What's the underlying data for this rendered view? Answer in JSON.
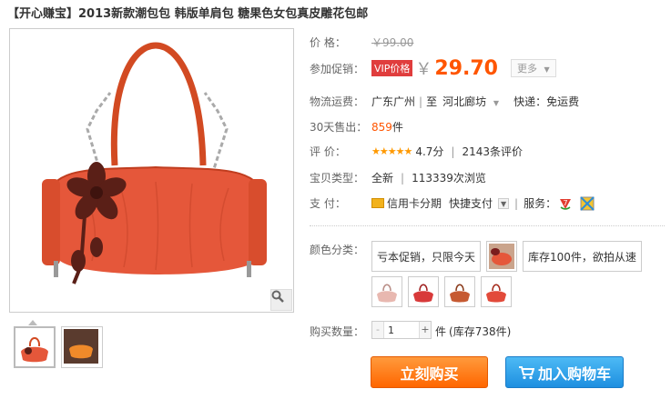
{
  "product": {
    "title": "【开心赚宝】2013新款潮包包 韩版单肩包 糖果色女包真皮雕花包邮"
  },
  "price": {
    "label": "价 格：",
    "original": "￥99.00",
    "promo_label": "参加促销：",
    "vip_tag": "VIP价格",
    "yen": "￥",
    "current": "29.70",
    "more": "更多"
  },
  "shipping": {
    "label": "物流运费：",
    "from": "广东广州",
    "to_word": "至",
    "to": "河北廊坊",
    "express": "快递：免运费"
  },
  "sales": {
    "label": "30天售出：",
    "count": "859",
    "unit": "件"
  },
  "rating": {
    "label": "评 价：",
    "stars": "★★★★★",
    "score": "4.7分",
    "reviews": "2143条评价"
  },
  "condition": {
    "label": "宝贝类型：",
    "type": "全新",
    "views": "113339次浏览"
  },
  "payment": {
    "label": "支 付：",
    "credit": "信用卡分期",
    "quick": "快捷支付",
    "service_label": "服务："
  },
  "colors": {
    "label": "颜色分类：",
    "option1": "亏本促销，只限今天",
    "option2": "库存100件，欲拍从速",
    "swatch_colors": [
      "#e5573a",
      "#e8b8b0",
      "#d83a3a",
      "#c65a32",
      "#e24a3a"
    ]
  },
  "quantity": {
    "label": "购买数量：",
    "minus": "-",
    "value": "1",
    "plus": "+",
    "unit": "件",
    "stock": "(库存738件)"
  },
  "actions": {
    "buy_now": "立刻购买",
    "add_cart": "加入购物车"
  },
  "theme": {
    "accent": "#ff5500",
    "buy_btn": "#ff7e1c",
    "cart_btn": "#2a9ae8"
  }
}
